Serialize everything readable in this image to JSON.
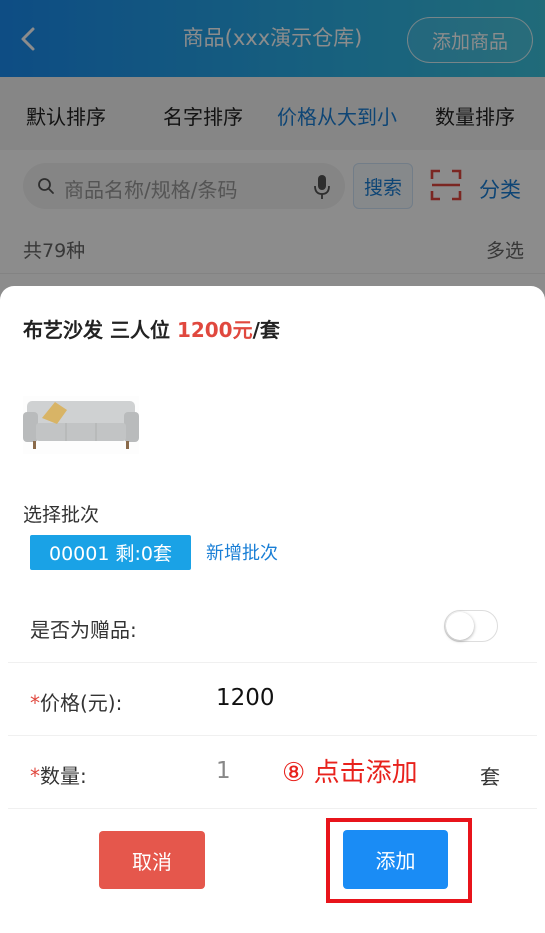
{
  "colors": {
    "header_start": "#1a8cf0",
    "header_end": "#3cc3dd",
    "accent_blue": "#1a7fd6",
    "price_red": "#e0483e",
    "cancel_red": "#e5574c",
    "highlight_red": "#e8141b"
  },
  "header": {
    "title": "商品(xxx演示仓库)",
    "add_button": "添加商品",
    "back_icon": "chevron-left-icon"
  },
  "sort_bar": {
    "items": [
      "默认排序",
      "名字排序",
      "价格从大到小",
      "数量排序"
    ],
    "active_index": 2
  },
  "search": {
    "placeholder": "商品名称/规格/条码",
    "button": "搜索",
    "category": "分类"
  },
  "list_header": {
    "count": "共79种",
    "multi_select": "多选"
  },
  "product": {
    "name": "布艺沙发  三人位  ",
    "price": "1200元",
    "unit_suffix": "/套",
    "image": "sofa-image"
  },
  "batch": {
    "label": "选择批次",
    "chip": "00001 剩:0套",
    "add_link": "新增批次"
  },
  "form": {
    "gift_label": "是否为赠品:",
    "gift_enabled": false,
    "price_label": "价格(元):",
    "price_value": "1200",
    "qty_label": "数量:",
    "qty_value": "1",
    "unit": "套",
    "required_mark": "*"
  },
  "annotation": {
    "text": "⑧ 点击添加"
  },
  "actions": {
    "cancel": "取消",
    "add": "添加"
  }
}
